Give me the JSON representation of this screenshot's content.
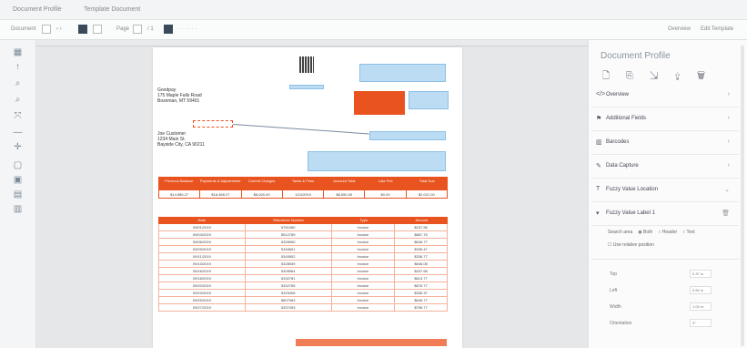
{
  "tabs": [
    "Document Profile",
    "Template Document"
  ],
  "toolbar": {
    "document_label": "Document",
    "page_label": "Page",
    "page_value": "1",
    "of_label": "/ 1",
    "right_actions": [
      "Overview",
      "Edit Template"
    ]
  },
  "left_tools": [
    "grid-icon",
    "pointer-icon",
    "zoom-in-icon",
    "zoom-out-icon",
    "fit-icon",
    "line-icon",
    "crosshair-icon",
    "frame-icon",
    "image-icon",
    "picture-icon",
    "table-icon"
  ],
  "document": {
    "sender": [
      "Goodpay",
      "175 Maple Falls Road",
      "Bozeman, MT 59401"
    ],
    "recipient": [
      "Joe Customer",
      "1234 Main St.",
      "Bayside City, CA 90211"
    ],
    "summary_headers": [
      "Previous Balance",
      "Payments & Adjustments",
      "Current Charges",
      "Taxes & Fees",
      "Account Total",
      "Late Fee",
      "Total Due"
    ],
    "summary_values": [
      "$14,986.27",
      "$18,468.27",
      "$6,620.00",
      "1/10/2019",
      "$8,550.00",
      "$0.00",
      "$2,021.00"
    ],
    "table_headers": [
      "Date",
      "Reference Number",
      "Type",
      "Amount"
    ],
    "table_rows": [
      [
        "09/01/2019",
        "5751080",
        "Invoice",
        "$237.96"
      ],
      [
        "09/04/2019",
        "5512789",
        "Invoice",
        "$867.75"
      ],
      [
        "09/06/2019",
        "5328990",
        "Invoice",
        "$646.77"
      ],
      [
        "09/09/2019",
        "5349601",
        "Invoice",
        "$336.47"
      ],
      [
        "09/11/2019",
        "5349502",
        "Invoice",
        "$336.77"
      ],
      [
        "09/13/2019",
        "5328939",
        "Invoice",
        "$646.08"
      ],
      [
        "09/16/2019",
        "5328964",
        "Invoice",
        "$437.68"
      ],
      [
        "09/18/2019",
        "5332781",
        "Invoice",
        "$613.77"
      ],
      [
        "09/20/2019",
        "5332765",
        "Invoice",
        "$576.77"
      ],
      [
        "09/23/2019",
        "5329408",
        "Invoice",
        "$336.37"
      ],
      [
        "09/25/2019",
        "8807963",
        "Invoice",
        "$646.77"
      ],
      [
        "09/27/2019",
        "5337493",
        "Invoice",
        "$796.77"
      ]
    ]
  },
  "panel": {
    "title": "Document Profile",
    "sections": [
      {
        "icon": "code-icon",
        "label": "Overview"
      },
      {
        "icon": "tags-icon",
        "label": "Additional Fields"
      },
      {
        "icon": "barcode-icon",
        "label": "Barcodes"
      },
      {
        "icon": "brush-icon",
        "label": "Data Capture"
      },
      {
        "icon": "text-icon",
        "label": "Fuzzy Value Location"
      }
    ],
    "subsection": "Fuzzy Value Label 1",
    "radio_label": "Search area",
    "radio_options": [
      "Both",
      "Header",
      "Text"
    ],
    "checkbox_label": "Use relative position",
    "fields": [
      {
        "label": "Top",
        "value": "0.37 in"
      },
      {
        "label": "Left",
        "value": "0.84 in"
      },
      {
        "label": "Width",
        "value": "1.00 in"
      },
      {
        "label": "Orientation",
        "value": "0°"
      }
    ]
  },
  "colors": {
    "accent": "#e8531f",
    "selection": "#bcdcf3",
    "panel_bg": "#fbfbfc"
  }
}
